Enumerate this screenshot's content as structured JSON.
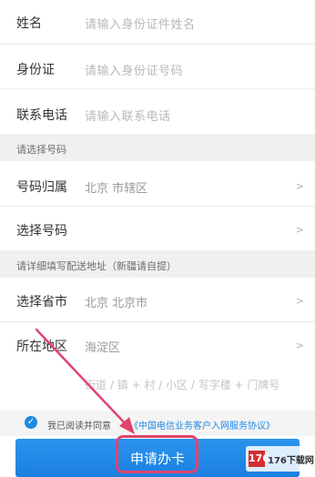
{
  "fields": {
    "name": {
      "label": "姓名",
      "placeholder": "请输入身份证件姓名"
    },
    "id_card": {
      "label": "身份证",
      "placeholder": "请输入身份证号码"
    },
    "phone": {
      "label": "联系电话",
      "placeholder": "请输入联系电话"
    }
  },
  "section_number": "请选择号码",
  "number_location": {
    "label": "号码归属",
    "value": "北京 市辖区",
    "chevron": ">"
  },
  "choose_number": {
    "label": "选择号码",
    "chevron": ">"
  },
  "section_address": "请详细填写配送地址（新疆请自提）",
  "province_city": {
    "label": "选择省市",
    "value": "北京 北京市",
    "chevron": ">"
  },
  "district": {
    "label": "所在地区",
    "value": "海淀区",
    "chevron": ">"
  },
  "address_detail_placeholder": "街道 / 镇 + 村 / 小区 / 写字楼 + 门牌号",
  "agreement": {
    "checked": true,
    "text": "我已阅读并同意",
    "link": "《中国电信业务客户入网服务协议》"
  },
  "apply_button": "申请办卡",
  "watermark": {
    "logo": "176",
    "text": "176下载网"
  },
  "colors": {
    "accent": "#1e88e5",
    "annotation": "#e0446e"
  }
}
